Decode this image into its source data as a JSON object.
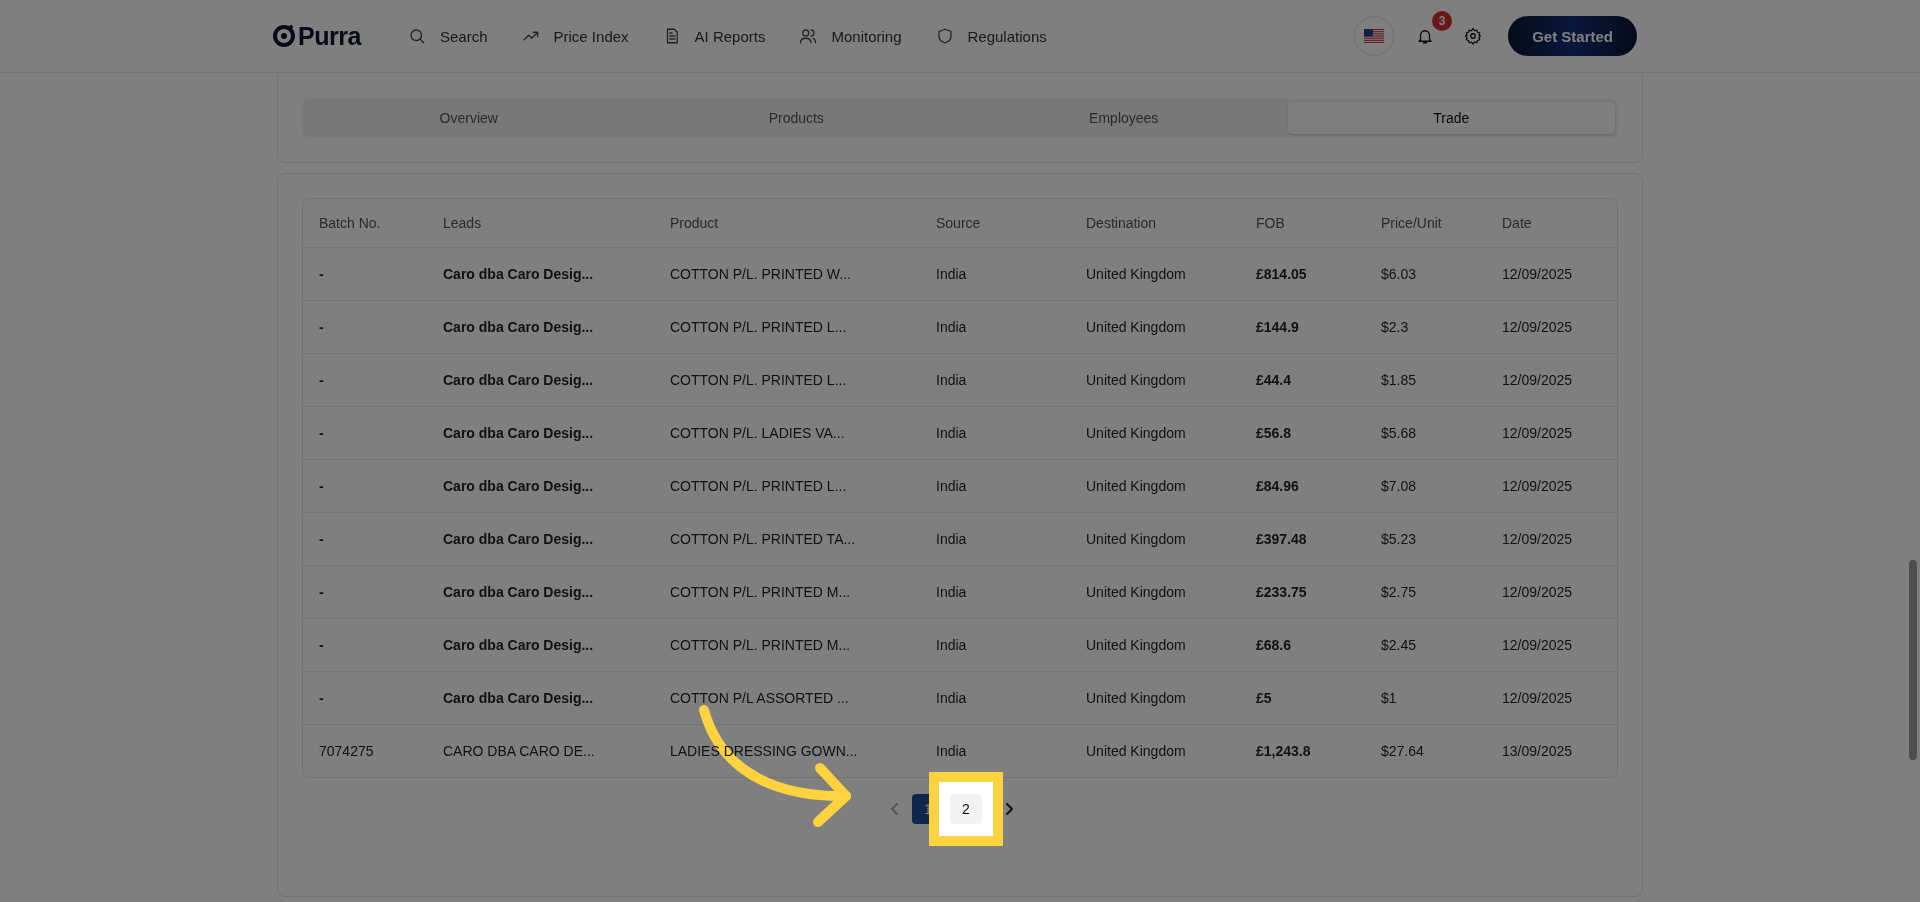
{
  "nav": {
    "brand": "Purra",
    "links": [
      "Search",
      "Price Index",
      "AI Reports",
      "Monitoring",
      "Regulations"
    ],
    "notifications": "3",
    "cta": "Get Started"
  },
  "tabs": [
    {
      "label": "Overview",
      "selected": false
    },
    {
      "label": "Products",
      "selected": false
    },
    {
      "label": "Employees",
      "selected": false
    },
    {
      "label": "Trade",
      "selected": true
    }
  ],
  "table": {
    "columns": [
      "Batch No.",
      "Leads",
      "Product",
      "Source",
      "Destination",
      "FOB",
      "Price/Unit",
      "Date"
    ],
    "rows": [
      {
        "batch": "-",
        "lead": "Caro dba Caro Desig...",
        "lead_bold": true,
        "product": "COTTON P/L. PRINTED W...",
        "source": "India",
        "destination": "United Kingdom",
        "fob": "£814.05",
        "price": "$6.03",
        "date": "12/09/2025"
      },
      {
        "batch": "-",
        "lead": "Caro dba Caro Desig...",
        "lead_bold": true,
        "product": "COTTON P/L. PRINTED L...",
        "source": "India",
        "destination": "United Kingdom",
        "fob": "£144.9",
        "price": "$2.3",
        "date": "12/09/2025"
      },
      {
        "batch": "-",
        "lead": "Caro dba Caro Desig...",
        "lead_bold": true,
        "product": "COTTON P/L. PRINTED L...",
        "source": "India",
        "destination": "United Kingdom",
        "fob": "£44.4",
        "price": "$1.85",
        "date": "12/09/2025"
      },
      {
        "batch": "-",
        "lead": "Caro dba Caro Desig...",
        "lead_bold": true,
        "product": "COTTON P/L. LADIES VA...",
        "source": "India",
        "destination": "United Kingdom",
        "fob": "£56.8",
        "price": "$5.68",
        "date": "12/09/2025"
      },
      {
        "batch": "-",
        "lead": "Caro dba Caro Desig...",
        "lead_bold": true,
        "product": "COTTON P/L. PRINTED L...",
        "source": "India",
        "destination": "United Kingdom",
        "fob": "£84.96",
        "price": "$7.08",
        "date": "12/09/2025"
      },
      {
        "batch": "-",
        "lead": "Caro dba Caro Desig...",
        "lead_bold": true,
        "product": "COTTON P/L. PRINTED TA...",
        "source": "India",
        "destination": "United Kingdom",
        "fob": "£397.48",
        "price": "$5.23",
        "date": "12/09/2025"
      },
      {
        "batch": "-",
        "lead": "Caro dba Caro Desig...",
        "lead_bold": true,
        "product": "COTTON P/L. PRINTED M...",
        "source": "India",
        "destination": "United Kingdom",
        "fob": "£233.75",
        "price": "$2.75",
        "date": "12/09/2025"
      },
      {
        "batch": "-",
        "lead": "Caro dba Caro Desig...",
        "lead_bold": true,
        "product": "COTTON P/L. PRINTED M...",
        "source": "India",
        "destination": "United Kingdom",
        "fob": "£68.6",
        "price": "$2.45",
        "date": "12/09/2025"
      },
      {
        "batch": "-",
        "lead": "Caro dba Caro Desig...",
        "lead_bold": true,
        "product": "COTTON P/L ASSORTED ...",
        "source": "India",
        "destination": "United Kingdom",
        "fob": "£5",
        "price": "$1",
        "date": "12/09/2025"
      },
      {
        "batch": "7074275",
        "lead": "CARO DBA CARO DE...",
        "lead_bold": false,
        "product": "LADIES DRESSING GOWN...",
        "source": "India",
        "destination": "United Kingdom",
        "fob": "£1,243.8",
        "price": "$27.64",
        "date": "13/09/2025"
      }
    ]
  },
  "pagination": {
    "previous_disabled": true,
    "pages": [
      {
        "label": "1",
        "selected": true,
        "highlighted": false
      },
      {
        "label": "2",
        "selected": false,
        "highlighted": true
      }
    ]
  }
}
